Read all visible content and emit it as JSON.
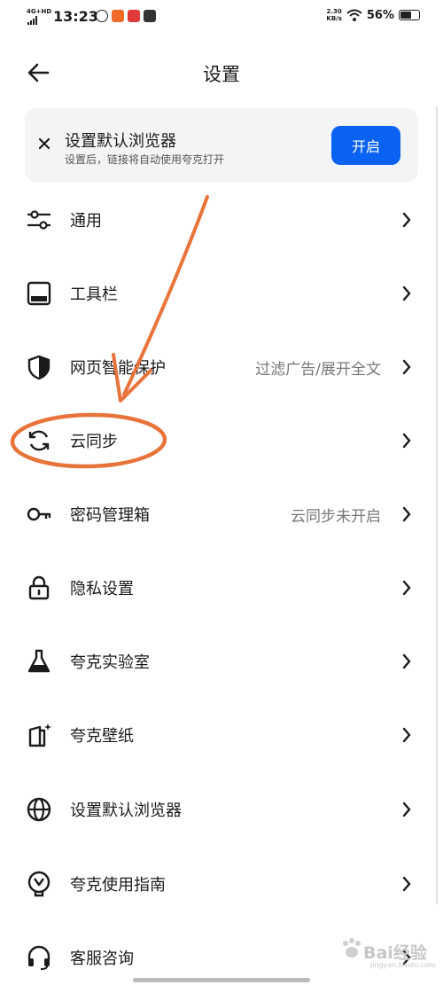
{
  "status_bar": {
    "network": "4G+HD",
    "time": "13:23",
    "speed_value": "2.30",
    "speed_unit": "KB/s",
    "battery": "56%"
  },
  "header": {
    "title": "设置"
  },
  "banner": {
    "title": "设置默认浏览器",
    "subtitle": "设置后，链接将自动使用夸克打开",
    "button_label": "开启"
  },
  "menu": [
    {
      "label": "通用",
      "value": "",
      "icon": "sliders-icon"
    },
    {
      "label": "工具栏",
      "value": "",
      "icon": "toolbar-icon"
    },
    {
      "label": "网页智能保护",
      "value": "过滤广告/展开全文",
      "icon": "shield-icon"
    },
    {
      "label": "云同步",
      "value": "",
      "icon": "sync-icon"
    },
    {
      "label": "密码管理箱",
      "value": "云同步未开启",
      "icon": "key-icon"
    },
    {
      "label": "隐私设置",
      "value": "",
      "icon": "lock-icon"
    },
    {
      "label": "夸克实验室",
      "value": "",
      "icon": "flask-icon"
    },
    {
      "label": "夸克壁纸",
      "value": "",
      "icon": "wallpaper-icon"
    },
    {
      "label": "设置默认浏览器",
      "value": "",
      "icon": "globe-icon"
    },
    {
      "label": "夸克使用指南",
      "value": "",
      "icon": "guide-icon"
    },
    {
      "label": "客服咨询",
      "value": "",
      "icon": "headset-icon"
    }
  ],
  "annotation_color": "#e8743b",
  "accent_color": "#0a62f2",
  "watermark": {
    "text": "Bai经验",
    "sub": "jingyan.baidu.com"
  }
}
